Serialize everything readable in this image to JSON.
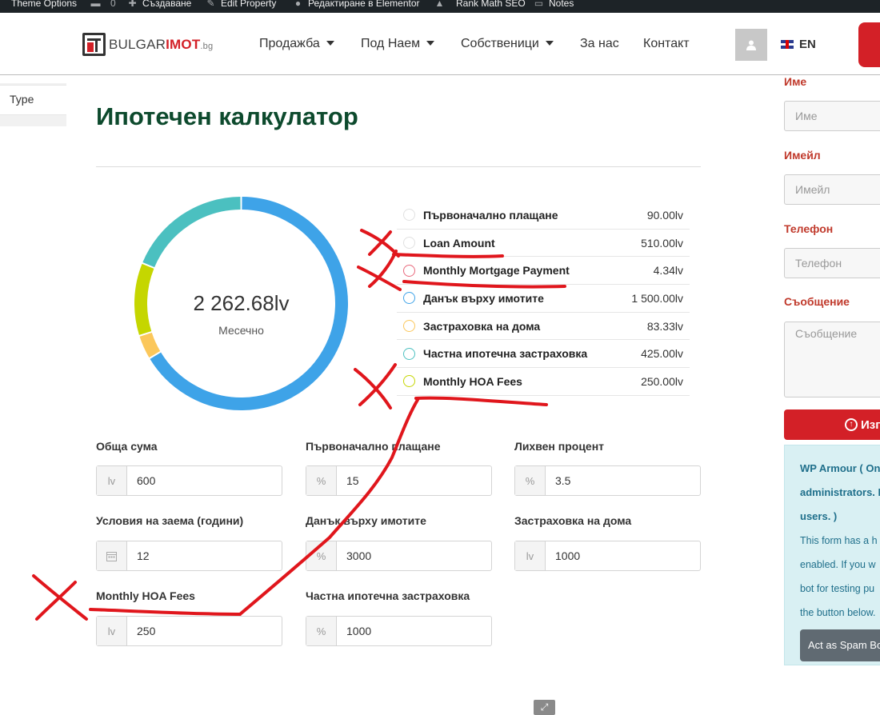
{
  "admin_bar": {
    "items": [
      {
        "label": "Theme Options",
        "icon": "theme-icon"
      },
      {
        "label": "",
        "count": "0",
        "icon": "comment-icon"
      },
      {
        "label": "Създаване",
        "icon": "plus-icon"
      },
      {
        "label": "Edit Property",
        "icon": "pencil-icon"
      },
      {
        "label": "Редактиране в Elementor",
        "icon": "elementor-icon"
      },
      {
        "label": "Rank Math SEO",
        "icon": "rankmath-icon"
      },
      {
        "label": "Notes",
        "icon": "notes-icon"
      }
    ]
  },
  "header": {
    "logo": {
      "part1": "BULGAR",
      "part2": "IMOT",
      "part3": ".bg"
    },
    "nav": [
      {
        "label": "Продажба",
        "dropdown": true
      },
      {
        "label": "Под Наем",
        "dropdown": true
      },
      {
        "label": "Собственици",
        "dropdown": true
      },
      {
        "label": "За нас",
        "dropdown": false
      },
      {
        "label": "Контакт",
        "dropdown": false
      }
    ],
    "language": "EN"
  },
  "left_panel": {
    "type_label": "Type"
  },
  "calculator": {
    "title": "Ипотечен калкулатор",
    "total": "2 262.68lv",
    "period": "Месечно",
    "breakdown": [
      {
        "label": "Първоначално плащане",
        "value": "90.00lv",
        "color": "#dddddd"
      },
      {
        "label": "Loan Amount",
        "value": "510.00lv",
        "color": "#dddddd"
      },
      {
        "label": "Monthly Mortgage Payment",
        "value": "4.34lv",
        "color": "#e8677a"
      },
      {
        "label": "Данък върху имотите",
        "value": "1 500.00lv",
        "color": "#3ea3e8"
      },
      {
        "label": "Застраховка на дома",
        "value": "83.33lv",
        "color": "#fbc75b"
      },
      {
        "label": "Частна ипотечна застраховка",
        "value": "425.00lv",
        "color": "#4bc0c0"
      },
      {
        "label": "Monthly HOA Fees",
        "value": "250.00lv",
        "color": "#c5d600"
      }
    ],
    "donut_segments": [
      {
        "label": "Данък върху имотите",
        "value": 1500,
        "color": "#3ea3e8"
      },
      {
        "label": "Застраховка на дома",
        "value": 83.33,
        "color": "#fbc75b"
      },
      {
        "label": "Monthly HOA Fees",
        "value": 250,
        "color": "#c5d600"
      },
      {
        "label": "Частна ипотечна застраховка",
        "value": 425,
        "color": "#4bc0c0"
      }
    ],
    "fields": [
      {
        "label": "Обща сума",
        "addon": "lv",
        "value": "600"
      },
      {
        "label": "Първоначално плащане",
        "addon": "%",
        "value": "15"
      },
      {
        "label": "Лихвен процент",
        "addon": "%",
        "value": "3.5"
      },
      {
        "label": "Условия на заема (години)",
        "addon": "calendar-icon",
        "value": "12"
      },
      {
        "label": "Данък върху имотите",
        "addon": "%",
        "value": "3000"
      },
      {
        "label": "Застраховка на дома",
        "addon": "lv",
        "value": "1000"
      },
      {
        "label": "Monthly HOA Fees",
        "addon": "lv",
        "value": "250"
      },
      {
        "label": "Частна ипотечна застраховка",
        "addon": "%",
        "value": "1000"
      }
    ]
  },
  "contact_form": {
    "name_label": "Име",
    "name_placeholder": "Име",
    "email_label": "Имейл",
    "email_placeholder": "Имейл",
    "phone_label": "Телефон",
    "phone_placeholder": "Телефон",
    "message_label": "Съобщение",
    "message_placeholder": "Съобщение",
    "submit_label": "Изп"
  },
  "wp_armour": {
    "line1": "WP Armour ( Onl",
    "line2": "administrators. H",
    "line3": "users. )",
    "line4": "This form has a h",
    "line5": "enabled. If you w",
    "line6": "bot for testing pu",
    "line7": "the button below.",
    "button": "Act as Spam Bo"
  },
  "colors": {
    "brand_red": "#d32027",
    "title_green": "#0d4a2d",
    "annotation_red": "#e0161c"
  }
}
